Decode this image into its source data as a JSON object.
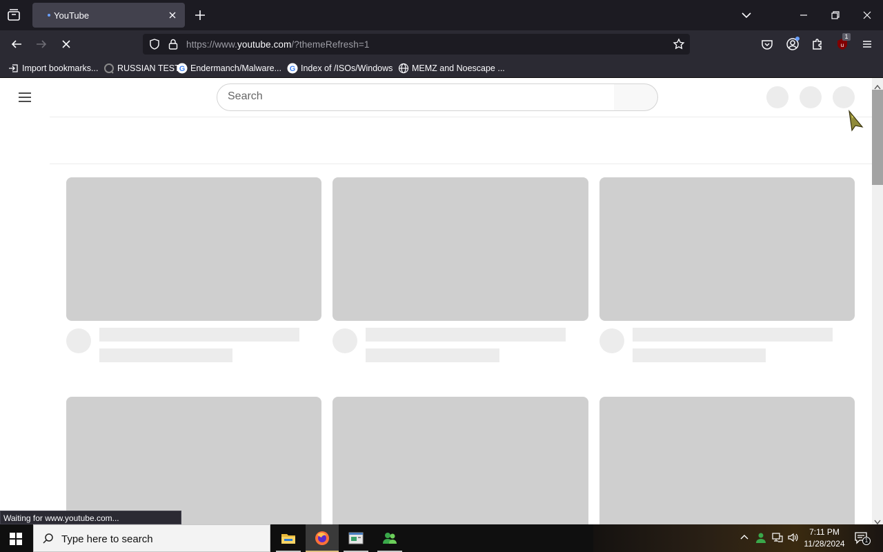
{
  "browser": {
    "tab": {
      "title": "YouTube"
    },
    "url": {
      "prefix": "https://www.",
      "domain": "youtube.com",
      "path": "/?themeRefresh=1"
    },
    "bookmarks": [
      {
        "label": "Import bookmarks...",
        "icon": "import-icon"
      },
      {
        "label": "RUSSIAN TEST",
        "icon": "favicon-icon"
      },
      {
        "label": "Endermanch/Malware...",
        "icon": "google-icon"
      },
      {
        "label": "Index of /ISOs/Windows",
        "icon": "google-icon"
      },
      {
        "label": "MEMZ and Noescape ...",
        "icon": "globe-icon"
      }
    ],
    "extensions_badge": "1",
    "status_text": "Waiting for www.youtube.com..."
  },
  "youtube": {
    "search": {
      "placeholder": "Search"
    }
  },
  "taskbar": {
    "search_placeholder": "Type here to search",
    "apps": [
      "file-explorer",
      "firefox",
      "app-window",
      "messenger"
    ],
    "clock": {
      "time": "7:11 PM",
      "date": "11/28/2024"
    },
    "notifications_count": "1"
  },
  "colors": {
    "firefox_chrome": "#2b2a33",
    "tabstrip": "#1c1b22",
    "skeleton_thumb": "#cfcfcf",
    "skeleton_line": "#ececec"
  }
}
